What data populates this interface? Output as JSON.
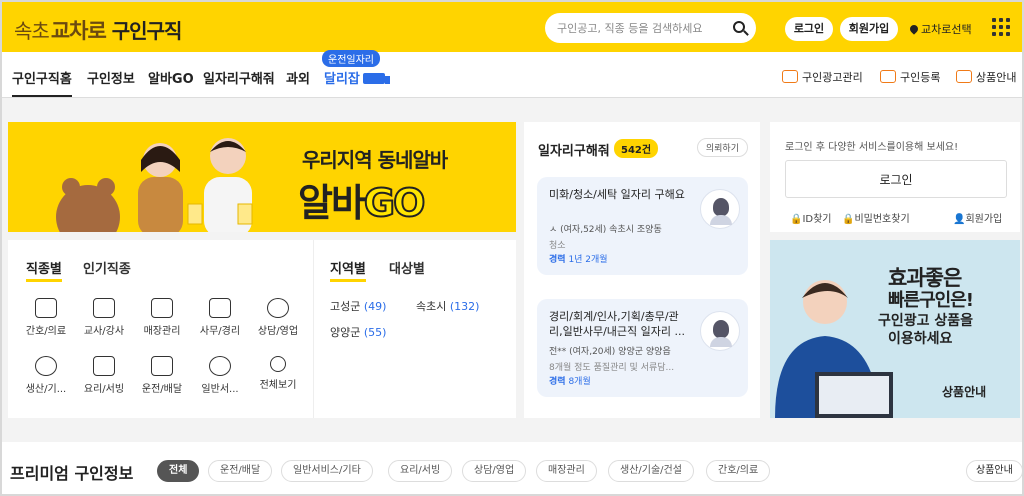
{
  "header": {
    "logo": {
      "part1": "속초",
      "part2": "교차로",
      "part3": "구인구직"
    },
    "search_placeholder": "구인공고, 직종 등을 검색하세요",
    "login_label": "로그인",
    "join_label": "회원가입",
    "region_label": "교차로선택"
  },
  "nav": {
    "items": [
      "구인구직홈",
      "구인정보",
      "알바GO",
      "일자리구해줘",
      "과외",
      "달리잡"
    ],
    "badge": "운전일자리",
    "right_links": [
      "구인광고관리",
      "구인등록",
      "상품안내"
    ]
  },
  "banner": {
    "line1": "우리지역 동네알바",
    "line2a": "알바",
    "line2b": "GO"
  },
  "category": {
    "tabs": [
      "직종별",
      "인기직종",
      "지역별",
      "대상별"
    ],
    "jobs": [
      {
        "label": "간호/의료",
        "icon": "medical-kit-icon"
      },
      {
        "label": "교사/강사",
        "icon": "teacher-board-icon"
      },
      {
        "label": "매장관리",
        "icon": "shirt-icon"
      },
      {
        "label": "사무/경리",
        "icon": "office-desk-icon"
      },
      {
        "label": "상담/영업",
        "icon": "phone-icon"
      },
      {
        "label": "생산/기...",
        "icon": "gear-icon"
      },
      {
        "label": "요리/서빙",
        "icon": "cutlery-icon"
      },
      {
        "label": "운전/배달",
        "icon": "truck-icon"
      },
      {
        "label": "일반서...",
        "icon": "chat-icon"
      },
      {
        "label": "전체보기",
        "icon": "search-icon"
      }
    ],
    "regions": [
      {
        "name": "고성군",
        "count": "(49)"
      },
      {
        "name": "속초시",
        "count": "(132)"
      },
      {
        "name": "양양군",
        "count": "(55)"
      }
    ]
  },
  "seek": {
    "title": "일자리구해줘",
    "count": "542건",
    "request": "의뢰하기",
    "cards": [
      {
        "title": "미화/청소/세탁 일자리 구해요",
        "meta": "ㅅ (여자,52세) 속초시 조양동",
        "desc": "청소",
        "exp_label": "경력",
        "exp": "1년 2개월"
      },
      {
        "title": "경리/회계/인사,기획/총무/관리,일반사무/내근직 일자리 ...",
        "meta": "전** (여자,20세) 양양군 양양읍",
        "desc": "8개월 정도 품질관리 및 서류담...",
        "exp_label": "경력",
        "exp": "8개월"
      }
    ]
  },
  "login": {
    "message": "로그인 후 다양한 서비스를이용해 보세요!",
    "button": "로그인",
    "find_id": "ID찾기",
    "find_pw": "비밀번호찾기",
    "join": "회원가입"
  },
  "ad": {
    "line1": "효과좋은",
    "line2": "빠른구인은!",
    "line3": "구인광고 상품을",
    "line4": "이용하세요",
    "cta": "상품안내"
  },
  "premium": {
    "title": "프리미엄 구인정보",
    "chips": [
      "전체",
      "운전/배달",
      "일반서비스/기타",
      "요리/서빙",
      "상담/영업",
      "매장관리",
      "생산/기술/건설",
      "간호/의료"
    ],
    "product": "상품안내"
  },
  "colors": {
    "brand_yellow": "#ffd400",
    "accent_blue": "#2b6de8",
    "orange": "#f07a17"
  }
}
